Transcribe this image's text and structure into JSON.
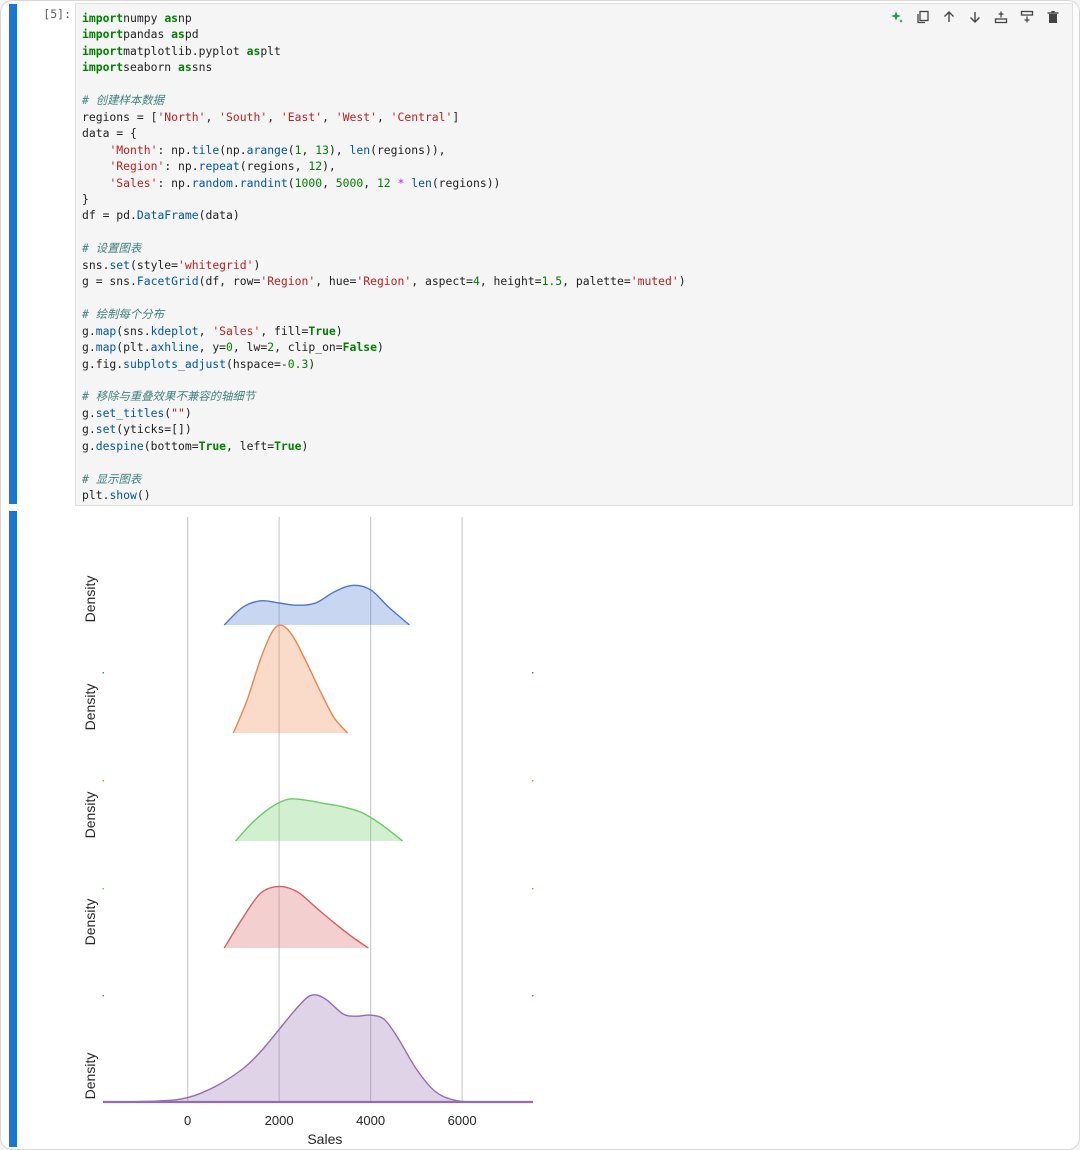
{
  "cell": {
    "prompt": "[5]:",
    "code_lines": [
      [
        [
          "kw",
          "import"
        ],
        [
          "",
          "numpy "
        ],
        [
          "kw",
          "as"
        ],
        [
          "",
          "np"
        ]
      ],
      [
        [
          "kw",
          "import"
        ],
        [
          "",
          "pandas "
        ],
        [
          "kw",
          "as"
        ],
        [
          "",
          "pd"
        ]
      ],
      [
        [
          "kw",
          "import"
        ],
        [
          "",
          "matplotlib.pyplot "
        ],
        [
          "kw",
          "as"
        ],
        [
          "",
          "plt"
        ]
      ],
      [
        [
          "kw",
          "import"
        ],
        [
          "",
          "seaborn "
        ],
        [
          "kw",
          "as"
        ],
        [
          "",
          "sns"
        ]
      ],
      [],
      [
        [
          "com",
          "# 创建样本数据"
        ]
      ],
      [
        [
          "",
          "regions = ["
        ],
        [
          "str",
          "'North'"
        ],
        [
          "",
          ", "
        ],
        [
          "str",
          "'South'"
        ],
        [
          "",
          ", "
        ],
        [
          "str",
          "'East'"
        ],
        [
          "",
          ", "
        ],
        [
          "str",
          "'West'"
        ],
        [
          "",
          ", "
        ],
        [
          "str",
          "'Central'"
        ],
        [
          "",
          "]"
        ]
      ],
      [
        [
          "",
          "data = {"
        ]
      ],
      [
        [
          "",
          "    "
        ],
        [
          "str",
          "'Month'"
        ],
        [
          "",
          ": np."
        ],
        [
          "fn",
          "tile"
        ],
        [
          "",
          "(np."
        ],
        [
          "fn",
          "arange"
        ],
        [
          "",
          "("
        ],
        [
          "num",
          "1"
        ],
        [
          "",
          ", "
        ],
        [
          "num",
          "13"
        ],
        [
          "",
          "), "
        ],
        [
          "fn",
          "len"
        ],
        [
          "",
          "(regions)),"
        ]
      ],
      [
        [
          "",
          "    "
        ],
        [
          "str",
          "'Region'"
        ],
        [
          "",
          ": np."
        ],
        [
          "fn",
          "repeat"
        ],
        [
          "",
          "(regions, "
        ],
        [
          "num",
          "12"
        ],
        [
          "",
          "),"
        ]
      ],
      [
        [
          "",
          "    "
        ],
        [
          "str",
          "'Sales'"
        ],
        [
          "",
          ": np."
        ],
        [
          "fn",
          "random"
        ],
        [
          "",
          "."
        ],
        [
          "fn",
          "randint"
        ],
        [
          "",
          "("
        ],
        [
          "num",
          "1000"
        ],
        [
          "",
          ", "
        ],
        [
          "num",
          "5000"
        ],
        [
          "",
          ", "
        ],
        [
          "num",
          "12"
        ],
        [
          "op",
          " * "
        ],
        [
          "fn",
          "len"
        ],
        [
          "",
          "(regions))"
        ]
      ],
      [
        [
          "",
          "}"
        ]
      ],
      [
        [
          "",
          "df = pd."
        ],
        [
          "fn",
          "DataFrame"
        ],
        [
          "",
          "(data)"
        ]
      ],
      [],
      [
        [
          "com",
          "# 设置图表"
        ]
      ],
      [
        [
          "",
          "sns."
        ],
        [
          "fn",
          "set"
        ],
        [
          "",
          "(style="
        ],
        [
          "str",
          "'whitegrid'"
        ],
        [
          "",
          ")"
        ]
      ],
      [
        [
          "",
          "g = sns."
        ],
        [
          "fn",
          "FacetGrid"
        ],
        [
          "",
          "(df, row="
        ],
        [
          "str",
          "'Region'"
        ],
        [
          "",
          ", hue="
        ],
        [
          "str",
          "'Region'"
        ],
        [
          "",
          ", aspect="
        ],
        [
          "num",
          "4"
        ],
        [
          "",
          ", height="
        ],
        [
          "num",
          "1.5"
        ],
        [
          "",
          ", palette="
        ],
        [
          "str",
          "'muted'"
        ],
        [
          "",
          ")"
        ]
      ],
      [],
      [
        [
          "com",
          "# 绘制每个分布"
        ]
      ],
      [
        [
          "",
          "g."
        ],
        [
          "fn",
          "map"
        ],
        [
          "",
          "(sns."
        ],
        [
          "fn",
          "kdeplot"
        ],
        [
          "",
          ", "
        ],
        [
          "str",
          "'Sales'"
        ],
        [
          "",
          ", fill="
        ],
        [
          "kw",
          "True"
        ],
        [
          "",
          ")"
        ]
      ],
      [
        [
          "",
          "g."
        ],
        [
          "fn",
          "map"
        ],
        [
          "",
          "(plt."
        ],
        [
          "fn",
          "axhline"
        ],
        [
          "",
          ", y="
        ],
        [
          "num",
          "0"
        ],
        [
          "",
          ", lw="
        ],
        [
          "num",
          "2"
        ],
        [
          "",
          ", clip_on="
        ],
        [
          "kw",
          "False"
        ],
        [
          "",
          ")"
        ]
      ],
      [
        [
          "",
          "g.fig."
        ],
        [
          "fn",
          "subplots_adjust"
        ],
        [
          "",
          "(hspace=-"
        ],
        [
          "num",
          "0.3"
        ],
        [
          "",
          ")"
        ]
      ],
      [],
      [
        [
          "com",
          "# 移除与重叠效果不兼容的轴细节"
        ]
      ],
      [
        [
          "",
          "g."
        ],
        [
          "fn",
          "set_titles"
        ],
        [
          "",
          "("
        ],
        [
          "str",
          "\"\""
        ],
        [
          "",
          ")"
        ]
      ],
      [
        [
          "",
          "g."
        ],
        [
          "fn",
          "set"
        ],
        [
          "",
          "(yticks=[])"
        ]
      ],
      [
        [
          "",
          "g."
        ],
        [
          "fn",
          "despine"
        ],
        [
          "",
          "(bottom="
        ],
        [
          "kw",
          "True"
        ],
        [
          "",
          ", left="
        ],
        [
          "kw",
          "True"
        ],
        [
          "",
          ")"
        ]
      ],
      [],
      [
        [
          "com",
          "# 显示图表"
        ]
      ],
      [
        [
          "",
          "plt."
        ],
        [
          "fn",
          "show"
        ],
        [
          "",
          "()"
        ]
      ]
    ]
  },
  "toolbar": {
    "icons": [
      "sparkle-icon",
      "copy-icon",
      "arrow-up-icon",
      "arrow-down-icon",
      "insert-above-icon",
      "insert-below-icon",
      "trash-icon"
    ]
  },
  "chart_data": {
    "type": "area",
    "xlabel": "Sales",
    "ylabel": "Density",
    "xticks": [
      0,
      2000,
      4000,
      6000
    ],
    "xlim": [
      -1850,
      7550
    ],
    "grid": true,
    "colors": [
      "#4878d0",
      "#ee854a",
      "#6acc64",
      "#d65f5f",
      "#956cb4"
    ],
    "series": [
      {
        "points": [
          [
            800,
            0
          ],
          [
            1200,
            0.16
          ],
          [
            1600,
            0.22
          ],
          [
            2000,
            0.2
          ],
          [
            2400,
            0.18
          ],
          [
            2800,
            0.2
          ],
          [
            3200,
            0.3
          ],
          [
            3600,
            0.36
          ],
          [
            4000,
            0.32
          ],
          [
            4400,
            0.16
          ],
          [
            4850,
            0
          ]
        ]
      },
      {
        "points": [
          [
            1000,
            0
          ],
          [
            1300,
            0.3
          ],
          [
            1600,
            0.68
          ],
          [
            1850,
            0.92
          ],
          [
            2050,
            0.98
          ],
          [
            2300,
            0.88
          ],
          [
            2600,
            0.64
          ],
          [
            2900,
            0.38
          ],
          [
            3200,
            0.14
          ],
          [
            3500,
            0
          ]
        ]
      },
      {
        "points": [
          [
            1050,
            0
          ],
          [
            1400,
            0.16
          ],
          [
            1800,
            0.3
          ],
          [
            2200,
            0.38
          ],
          [
            2600,
            0.37
          ],
          [
            3000,
            0.34
          ],
          [
            3400,
            0.31
          ],
          [
            3800,
            0.26
          ],
          [
            4200,
            0.16
          ],
          [
            4700,
            0
          ]
        ]
      },
      {
        "points": [
          [
            800,
            0
          ],
          [
            1200,
            0.27
          ],
          [
            1600,
            0.5
          ],
          [
            2000,
            0.56
          ],
          [
            2400,
            0.51
          ],
          [
            2800,
            0.37
          ],
          [
            3200,
            0.23
          ],
          [
            3600,
            0.1
          ],
          [
            3950,
            0
          ]
        ]
      },
      {
        "points": [
          [
            -1850,
            0
          ],
          [
            -600,
            0.01
          ],
          [
            0,
            0.04
          ],
          [
            600,
            0.14
          ],
          [
            1200,
            0.3
          ],
          [
            1600,
            0.46
          ],
          [
            2000,
            0.66
          ],
          [
            2400,
            0.86
          ],
          [
            2700,
            0.97
          ],
          [
            3000,
            0.94
          ],
          [
            3400,
            0.8
          ],
          [
            3700,
            0.78
          ],
          [
            4000,
            0.79
          ],
          [
            4300,
            0.75
          ],
          [
            4600,
            0.58
          ],
          [
            5000,
            0.3
          ],
          [
            5400,
            0.1
          ],
          [
            5800,
            0.02
          ],
          [
            6300,
            0
          ],
          [
            7550,
            0
          ]
        ]
      }
    ]
  }
}
